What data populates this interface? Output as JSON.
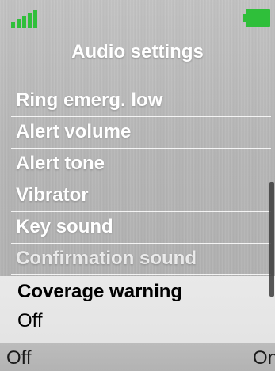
{
  "status": {
    "signal_icon": "signal-bars-icon",
    "battery_icon": "battery-icon",
    "accent_color": "#2fbf3a"
  },
  "screen": {
    "title": "Audio settings"
  },
  "menu": {
    "items": [
      {
        "label": "Ring emerg. low"
      },
      {
        "label": "Alert volume"
      },
      {
        "label": "Alert tone"
      },
      {
        "label": "Vibrator"
      },
      {
        "label": "Key sound"
      },
      {
        "label": "Confirmation sound"
      }
    ],
    "selected": {
      "label": "Coverage warning",
      "value": "Off"
    }
  },
  "softkeys": {
    "left": "Off",
    "right": "On"
  }
}
